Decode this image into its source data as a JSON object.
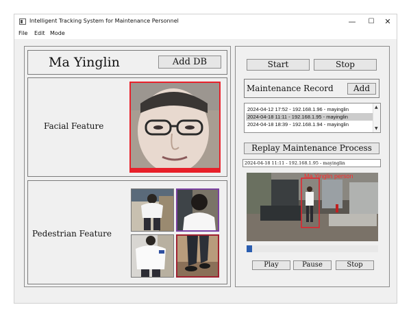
{
  "window": {
    "title": "Intelligent Tracking System for Maintenance Personnel",
    "controls": {
      "minimize": "—",
      "maximize": "☐",
      "close": "✕"
    }
  },
  "menu": [
    "File",
    "Edit",
    "Mode"
  ],
  "left": {
    "person_name": "Ma Yinglin",
    "add_db_label": "Add DB",
    "facial_label": "Facial Feature",
    "pedestrian_label": "Pedestrian Feature"
  },
  "right": {
    "start_label": "Start",
    "stop_label": "Stop",
    "record_title": "Maintenance Record",
    "record_add_label": "Add",
    "records": [
      "2024-04-12 17:52 - 192.168.1.96 - mayinglin",
      "2024-04-18 11:11 - 192.168.1.95 - mayinglin",
      "2024-04-18 18:39 - 192.168.1.94 - mayinglin"
    ],
    "selected_index": 1,
    "replay_title": "Replay Maintenance Process",
    "replay_value": "2024-04-18 11:11 - 192.168.1.95 - mayinglin",
    "detection_label": "Ma Yinglin person",
    "progress": 0.04,
    "play_label": "Play",
    "pause_label": "Pause"
  },
  "colors": {
    "face_border": "#e8202a",
    "detection_box": "#e8202a",
    "progress_fill": "#2a5db0",
    "ped_border_top_right": "#7a3fa0",
    "ped_border_bottom_right": "#a02030"
  }
}
